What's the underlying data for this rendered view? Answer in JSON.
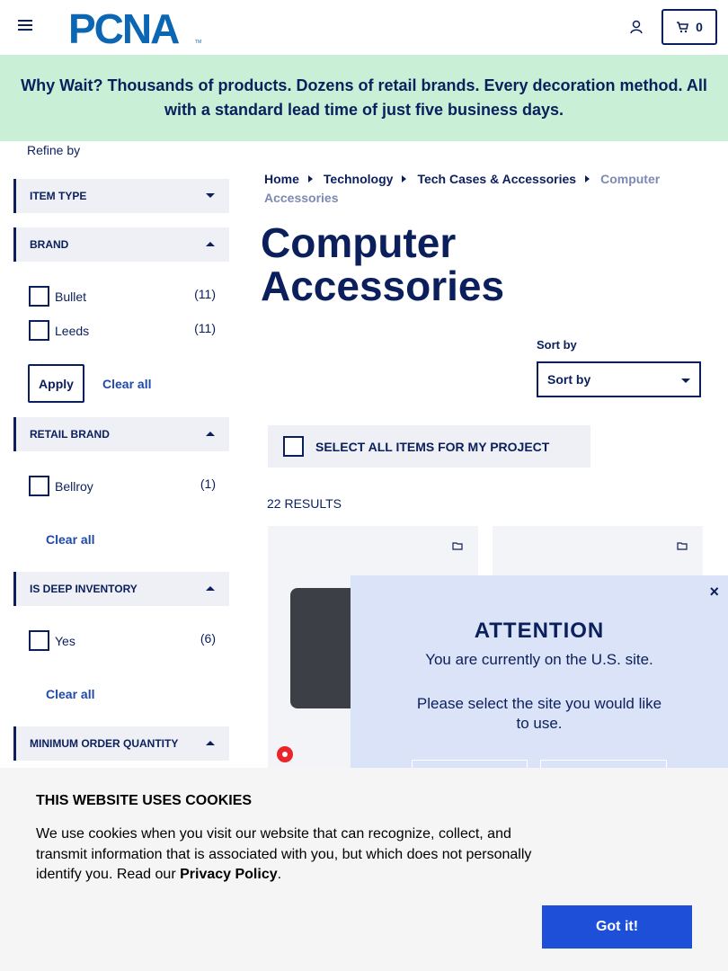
{
  "header": {
    "logo_text": "PCNA",
    "cart_count": "0"
  },
  "promo": {
    "text": "Why Wait? Thousands of products. Dozens of retail brands. Every decoration method. All with a standard lead time of just five business days."
  },
  "sidebar": {
    "refine_label": "Refine by",
    "facets": {
      "item_type": {
        "title": "ITEM TYPE"
      },
      "brand": {
        "title": "BRAND",
        "options": [
          {
            "label": "Bullet",
            "count": "(11)"
          },
          {
            "label": "Leeds",
            "count": "(11)"
          }
        ],
        "apply_label": "Apply",
        "clear_label": "Clear all"
      },
      "retail_brand": {
        "title": "RETAIL BRAND",
        "options": [
          {
            "label": "Bellroy",
            "count": "(1)"
          }
        ],
        "clear_label": "Clear all"
      },
      "deep_inventory": {
        "title": "IS DEEP INVENTORY",
        "options": [
          {
            "label": "Yes",
            "count": "(6)"
          }
        ],
        "clear_label": "Clear all"
      },
      "min_order_qty": {
        "title": "MINIMUM ORDER QUANTITY"
      }
    }
  },
  "breadcrumb": {
    "items": [
      "Home",
      "Technology",
      "Tech Cases & Accessories"
    ],
    "current": "Computer Accessories"
  },
  "main": {
    "title": "Computer Accessories",
    "sort_label": "Sort by",
    "sort_value": "Sort by",
    "select_all_label": "SELECT ALL ITEMS FOR MY PROJECT",
    "results_count": "22 RESULTS"
  },
  "modal": {
    "close": "×",
    "title": "ATTENTION",
    "message1": "You are currently on the U.S. site.",
    "message2": "Please select the site you would like to use."
  },
  "cookie": {
    "title": "THIS WEBSITE USES COOKIES",
    "text": "We use cookies when you visit our website that can recognize, collect, and transmit information that is associated with you, but which does not personally identify you. Read our ",
    "link": "Privacy Policy",
    "period": ".",
    "button": "Got it!"
  },
  "colors": {
    "navy": "#0b1f5c",
    "promo_bg": "#c9f0d6",
    "modal_bg": "#dbe3f8",
    "cookie_button": "#1d4fd8"
  }
}
